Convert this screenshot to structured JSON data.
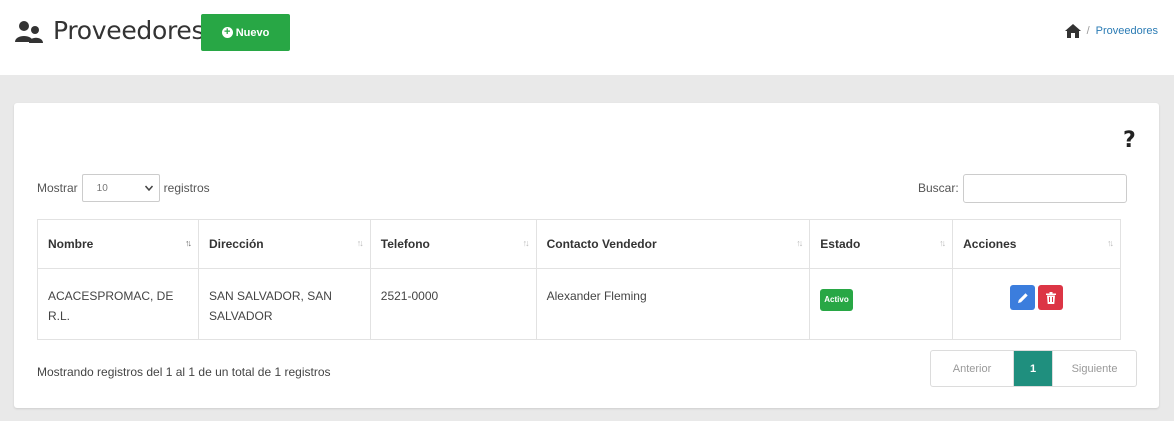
{
  "header": {
    "title": "Proveedores",
    "new_button": "Nuevo",
    "breadcrumb": {
      "separator": "/",
      "current": "Proveedores"
    }
  },
  "help": "?",
  "length_control": {
    "prefix": "Mostrar",
    "value": "10",
    "suffix": "registros"
  },
  "search": {
    "label": "Buscar:",
    "value": ""
  },
  "table": {
    "columns": [
      "Nombre",
      "Dirección",
      "Telefono",
      "Contacto Vendedor",
      "Estado",
      "Acciones"
    ],
    "rows": [
      {
        "nombre": "ACACESPROMAC, DE R.L.",
        "direccion": "SAN SALVADOR, SAN SALVADOR",
        "telefono": "2521-0000",
        "contacto": "Alexander Fleming",
        "estado": "Activo"
      }
    ]
  },
  "footer": {
    "info": "Mostrando registros del 1 al 1 de un total de 1 registros",
    "prev": "Anterior",
    "page": "1",
    "next": "Siguiente"
  },
  "colors": {
    "success": "#28a745",
    "primary": "#3b7ddd",
    "danger": "#dc3545",
    "page_active": "#1f8f7e"
  }
}
